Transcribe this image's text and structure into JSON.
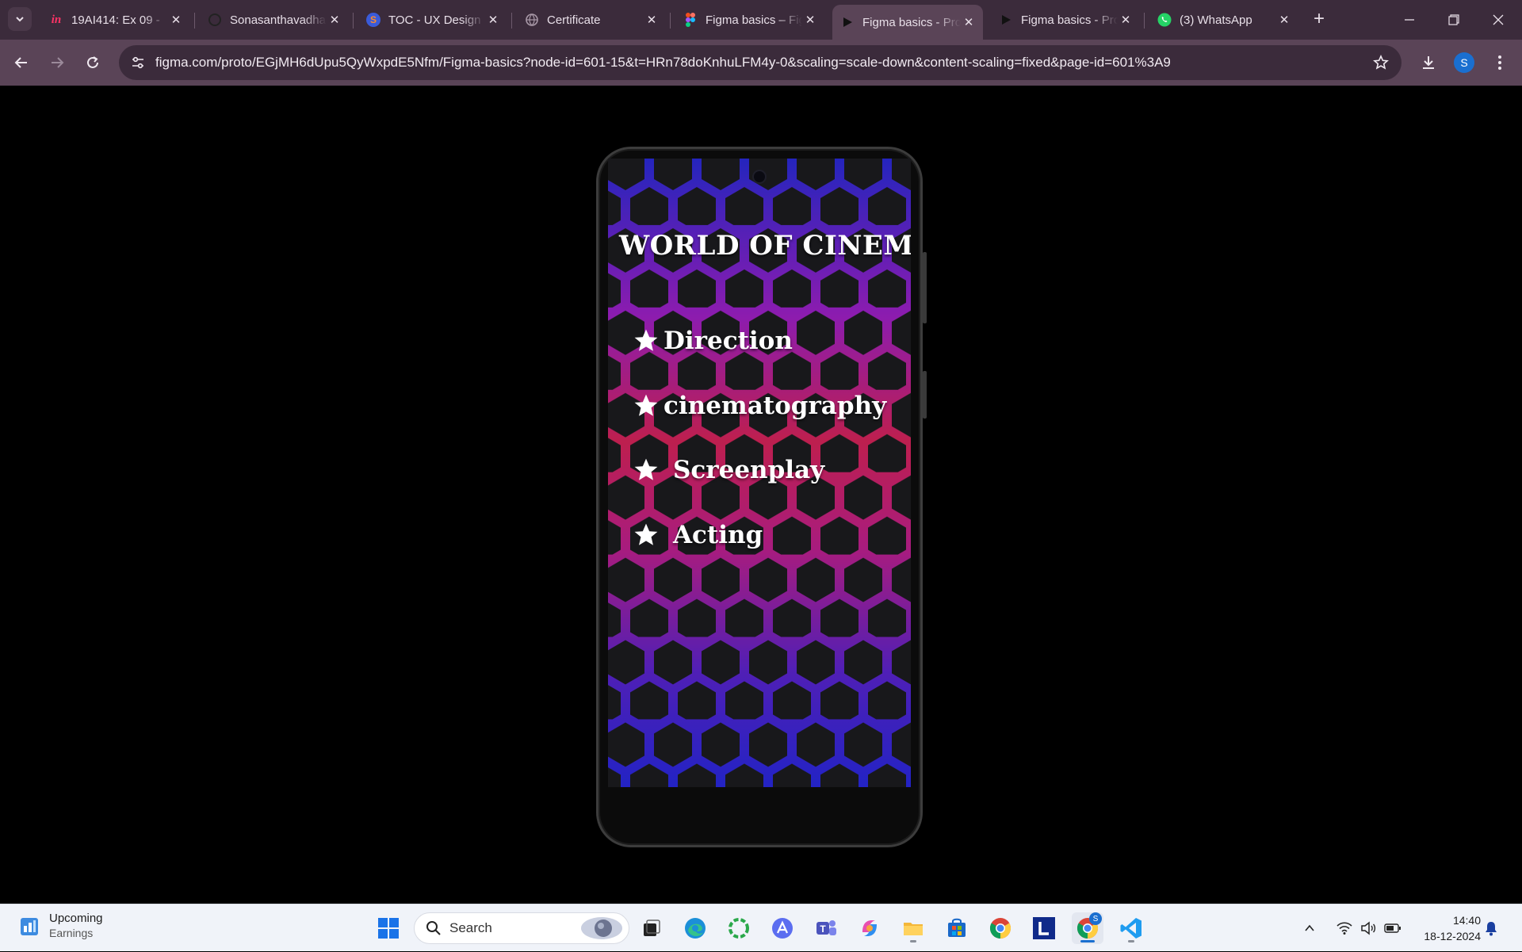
{
  "browser": {
    "tabs": [
      {
        "title": "19AI414: Ex 09 -",
        "icon": "invision-icon"
      },
      {
        "title": "Sonasanthavadhani",
        "icon": "github-icon"
      },
      {
        "title": "TOC - UX Design",
        "icon": "s-logo-icon"
      },
      {
        "title": "Certificate",
        "icon": "globe-icon"
      },
      {
        "title": "Figma basics – Figma",
        "icon": "figma-icon"
      },
      {
        "title": "Figma basics - Prototype",
        "icon": "play-icon",
        "active": true
      },
      {
        "title": "Figma basics - Prototype",
        "icon": "play-icon"
      },
      {
        "title": "(3) WhatsApp",
        "icon": "whatsapp-icon"
      }
    ],
    "url": "figma.com/proto/EGjMH6dUpu5QyWxpdE5Nfm/Figma-basics?node-id=601-15&t=HRn78doKnhuLFM4y-0&scaling=scale-down&content-scaling=fixed&page-id=601%3A9",
    "profile_initial": "S"
  },
  "prototype": {
    "title": "WORLD OF CINEMA",
    "menu": [
      {
        "label": "Direction"
      },
      {
        "label": "cinematography"
      },
      {
        "label": "Screenplay"
      },
      {
        "label": "Acting"
      }
    ]
  },
  "taskbar": {
    "weather_title": "Upcoming",
    "weather_subtitle": "Earnings",
    "search_label": "Search",
    "time": "14:40",
    "date": "18-12-2024",
    "chrome_badge": "S"
  },
  "colors": {
    "tab_strip": "#3b2b3b",
    "toolbar": "#5a4457",
    "hex_top": "#2a2ad8",
    "hex_mid": "#d8245a",
    "hex_purple": "#a020c8"
  }
}
